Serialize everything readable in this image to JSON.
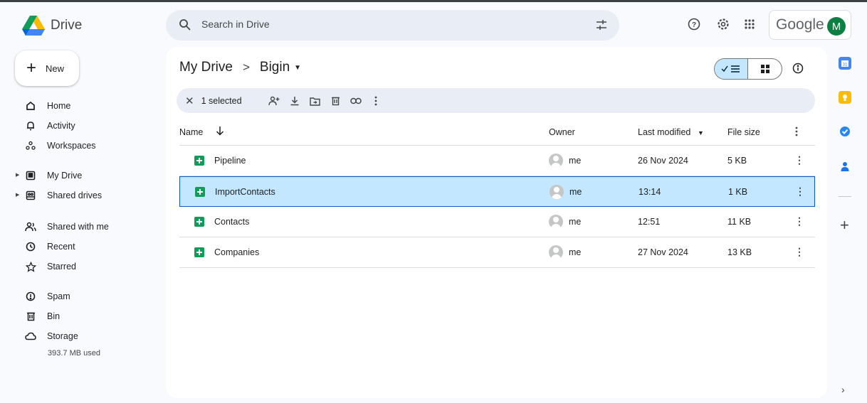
{
  "app": {
    "name": "Drive",
    "brand_color": "#0b57d0"
  },
  "header": {
    "search_placeholder": "Search in Drive",
    "google_label": "Google",
    "avatar_initial": "M",
    "icons": [
      "search-icon",
      "filter-icon",
      "help-icon",
      "settings-icon",
      "apps-icon"
    ]
  },
  "sidebar": {
    "new_label": "New",
    "items": [
      {
        "label": "Home",
        "icon": "home-icon"
      },
      {
        "label": "Activity",
        "icon": "bell-icon"
      },
      {
        "label": "Workspaces",
        "icon": "workspaces-icon"
      },
      {
        "label": "My Drive",
        "icon": "my-drive-icon"
      },
      {
        "label": "Shared drives",
        "icon": "shared-drives-icon"
      },
      {
        "label": "Shared with me",
        "icon": "people-icon"
      },
      {
        "label": "Recent",
        "icon": "clock-icon"
      },
      {
        "label": "Starred",
        "icon": "star-icon"
      },
      {
        "label": "Spam",
        "icon": "spam-icon"
      },
      {
        "label": "Bin",
        "icon": "bin-icon"
      },
      {
        "label": "Storage",
        "icon": "cloud-icon"
      }
    ],
    "storage_used": "393.7 MB used"
  },
  "main": {
    "breadcrumb": {
      "root": "My Drive",
      "separator": ">",
      "current": "Bigin"
    },
    "selection": {
      "count_label": "1 selected"
    },
    "columns": {
      "name": "Name",
      "owner": "Owner",
      "modified": "Last modified",
      "size": "File size"
    },
    "files": [
      {
        "name": "Pipeline",
        "owner": "me",
        "modified": "26 Nov 2024",
        "size": "5 KB",
        "selected": false
      },
      {
        "name": "ImportContacts",
        "owner": "me",
        "modified": "13:14",
        "size": "1 KB",
        "selected": true
      },
      {
        "name": "Contacts",
        "owner": "me",
        "modified": "12:51",
        "size": "11 KB",
        "selected": false
      },
      {
        "name": "Companies",
        "owner": "me",
        "modified": "27 Nov 2024",
        "size": "13 KB",
        "selected": false
      }
    ]
  },
  "rail": {
    "icons": [
      "calendar-icon",
      "keep-icon",
      "tasks-icon",
      "contacts-icon"
    ]
  }
}
